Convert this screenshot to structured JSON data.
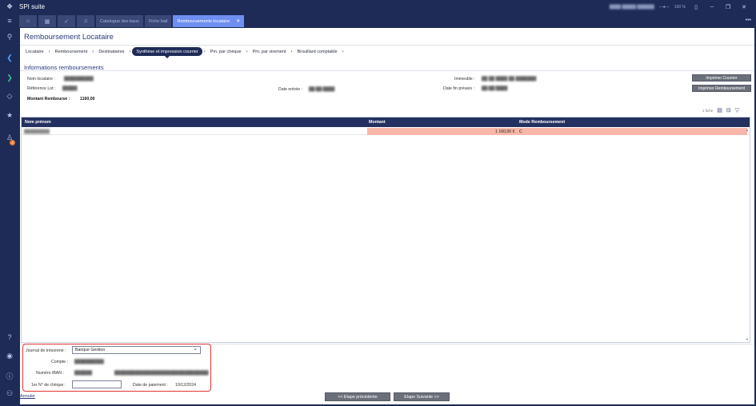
{
  "app": {
    "title": "SPI suite",
    "zoom": "100 %",
    "blurred_info": "████ █████ ██████"
  },
  "tabs": [
    {
      "label": "Catalogue des baux"
    },
    {
      "label": "Fiche bail"
    },
    {
      "label": "Remboursements locataire",
      "close": "✕"
    }
  ],
  "page": {
    "title": "Remboursement Locataire"
  },
  "steps": [
    {
      "label": "Locataire"
    },
    {
      "label": "Remboursement"
    },
    {
      "label": "Destinataires"
    },
    {
      "label": "Synthèse et impression courrier"
    },
    {
      "label": "Pm. par chèque"
    },
    {
      "label": "Pm. par virement"
    },
    {
      "label": "Brouillard comptable"
    }
  ],
  "info": {
    "section_title": "Informations remboursements",
    "nom_label": "Nom locataire :",
    "nom_value": "██████████",
    "ref_label": "Référence Lot :",
    "ref_value": "█████",
    "date_entree_label": "Date entrée :",
    "date_entree_value": "██/██/████",
    "immeuble_label": "Immeuble :",
    "immeuble_value": "██ ██ ████ ██ ███████",
    "date_fin_label": "Date fin préavis :",
    "date_fin_value": "██/██/████",
    "montant_label": "Montant Remboursé :",
    "montant_value": "1160,00"
  },
  "buttons": {
    "imprimer_courrier": "Imprimer Courrier",
    "imprimer_remboursement": "Imprimer Remboursement",
    "etape_precedente": "<< Etape précédente",
    "etape_suivante": "Etape Suivante >>",
    "annuler": "Annuler"
  },
  "grid": {
    "count": "1 fiche",
    "columns": [
      "Nom prénom",
      "Montant",
      "Mode Remboursement"
    ],
    "rows": [
      {
        "nom": "█████████",
        "montant": "1 160,00 €",
        "mode": "C"
      }
    ]
  },
  "form": {
    "journal_label": "Journal de trésorerie :",
    "journal_value": "Banque Gestion",
    "compte_label": "Compte :",
    "compte_value": "██████████",
    "iban_label": "Numéro IBAN :",
    "iban_value": "██████",
    "iban_value2": "████████████████████████████████",
    "cheque_label": "1er N° de chèque :",
    "date_paiement_label": "Date de paiement :",
    "date_paiement_value": "10/12/2024"
  }
}
